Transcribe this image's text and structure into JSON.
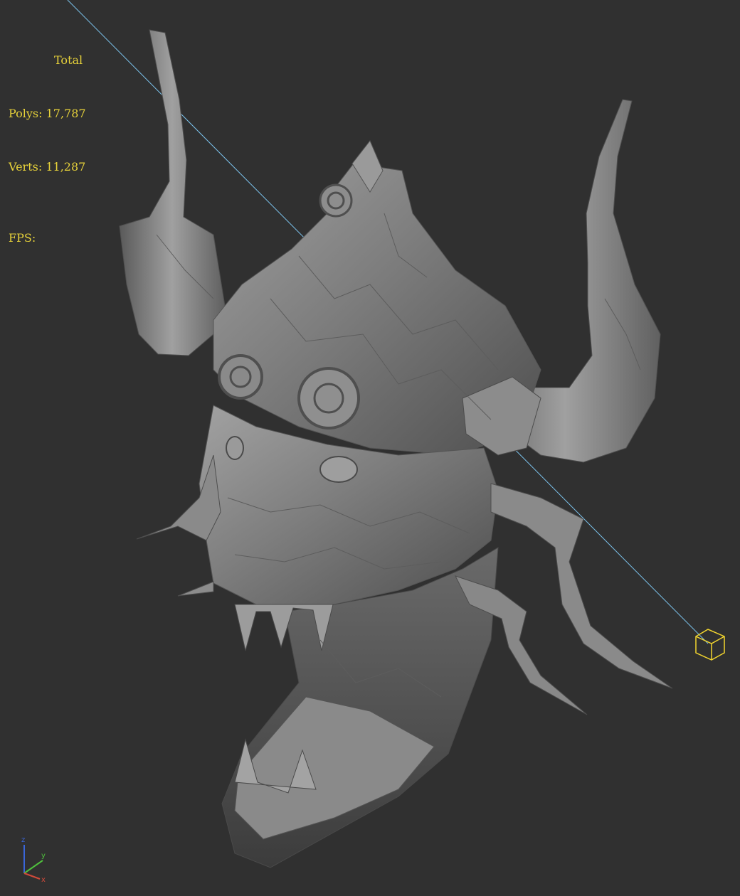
{
  "stats": {
    "title": "Total",
    "polys_label": "Polys:",
    "polys_value": "17,787",
    "verts_label": "Verts:",
    "verts_value": "11,287",
    "fps_label": "FPS:"
  },
  "gizmo": {
    "axes": [
      "z",
      "y",
      "x"
    ],
    "colors": {
      "x": "#d24a3a",
      "y": "#4fbf3d",
      "z": "#3a66d8"
    }
  },
  "colors": {
    "background": "#303030",
    "mesh": "#7b7b7b",
    "light_line": "#7cc4ee",
    "light_icon": "#f2d52e",
    "stats_text": "#e7d23a"
  }
}
